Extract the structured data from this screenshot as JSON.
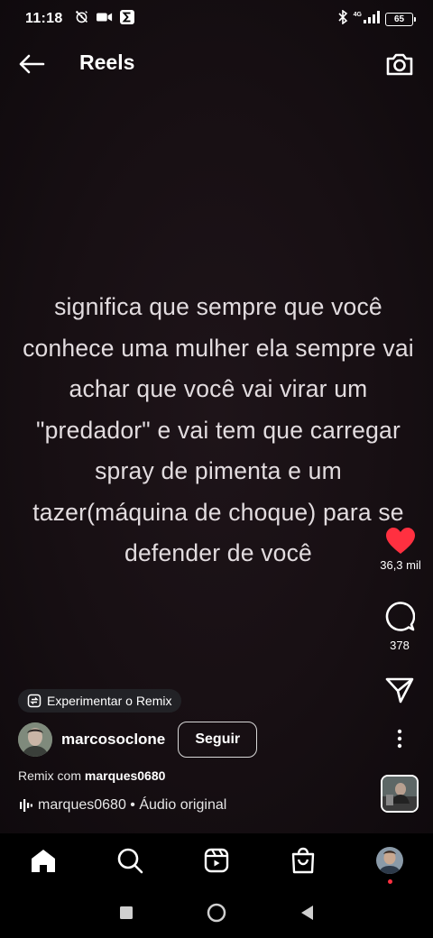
{
  "status_bar": {
    "time": "11:18",
    "network": "4G",
    "battery": "65",
    "icons_left": [
      "alarm-off-icon",
      "video-camera-icon",
      "sigma-app-icon"
    ],
    "icons_right": [
      "bluetooth-icon",
      "signal-icon",
      "battery-icon"
    ]
  },
  "header": {
    "title": "Reels",
    "back_icon": "arrow-left-icon",
    "camera_icon": "camera-icon"
  },
  "video": {
    "caption": "significa que sempre que você conhece uma mulher ela sempre vai achar que você vai virar um \"predador\" e vai tem que carregar spray de pimenta e um tazer(máquina de choque) para se defender de você"
  },
  "actions": {
    "like_count": "36,3 mil",
    "comment_count": "378",
    "like_color": "#ff3040",
    "icons": [
      "heart-icon",
      "comment-icon",
      "share-icon",
      "more-icon"
    ]
  },
  "post": {
    "remix_chip": "Experimentar o Remix",
    "username": "marcosoclone",
    "follow_label": "Seguir",
    "remix_prefix": "Remix com",
    "remix_user": "marques0680",
    "audio_text": "marques0680 • Áudio original"
  },
  "bottom_nav": {
    "items": [
      "home-icon",
      "search-icon",
      "reels-icon",
      "shop-icon",
      "profile-avatar"
    ],
    "notification_color": "#ff3040"
  },
  "system_nav": {
    "items": [
      "recents-button",
      "home-button",
      "back-button"
    ]
  }
}
